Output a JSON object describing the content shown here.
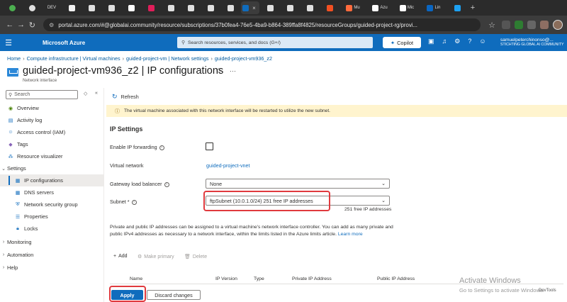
{
  "browser": {
    "tabs": [
      {
        "label": "",
        "color": "#4caf50"
      },
      {
        "label": "",
        "color": "#e0e0e0"
      },
      {
        "label": "DEV",
        "color": "#111111"
      },
      {
        "label": "",
        "color": "#f2f2f2"
      },
      {
        "label": "",
        "color": "#e0e0e0"
      },
      {
        "label": "",
        "color": "#e0e0e0"
      },
      {
        "label": "",
        "color": "#ffffff"
      },
      {
        "label": "",
        "color": "#e01e5a"
      },
      {
        "label": "",
        "color": "#e0e0e0"
      },
      {
        "label": "",
        "color": "#e0e0e0"
      },
      {
        "label": "",
        "color": "#e0e0e0"
      },
      {
        "label": "",
        "color": "#e0e0e0"
      },
      {
        "label": "",
        "color": "#e0e0e0"
      },
      {
        "label": "",
        "color": "#0f6cbd"
      },
      {
        "label": "",
        "color": "#e0e0e0"
      },
      {
        "label": "",
        "color": "#e0e0e0"
      },
      {
        "label": "",
        "color": "#e0e0e0"
      },
      {
        "label": "",
        "color": "#f25022"
      },
      {
        "label": "Mu",
        "color": "#ff6b3d"
      },
      {
        "label": "Azu",
        "color": "#ffffff"
      },
      {
        "label": "Mic",
        "color": "#ffffff"
      },
      {
        "label": "Lin",
        "color": "#0a66c2"
      },
      {
        "label": "",
        "color": "#1da1f2"
      }
    ],
    "url": "portal.azure.com/#@globalai.community/resource/subscriptions/37b0fea4-76e5-4ba9-b864-389ffa8f4825/resourceGroups/guided-project-rg/provi..."
  },
  "azure": {
    "brand": "Microsoft Azure",
    "search_placeholder": "Search resources, services, and docs (G+/)",
    "copilot_label": "Copilot",
    "user_name": "samuelpeterchinonso@...",
    "user_tenant": "STICHTING GLOBAL AI COMMUNITY"
  },
  "breadcrumb": {
    "items": [
      "Home",
      "Compute infrastructure | Virtual machines",
      "guided-project-vm | Network settings",
      "guided-project-vm936_z2"
    ]
  },
  "header": {
    "title": "guided-project-vm936_z2 | IP configurations",
    "subtitle": "Network interface"
  },
  "nav": {
    "search_placeholder": "Search",
    "items": [
      {
        "label": "Overview"
      },
      {
        "label": "Activity log"
      },
      {
        "label": "Access control (IAM)"
      },
      {
        "label": "Tags"
      },
      {
        "label": "Resource visualizer"
      },
      {
        "label": "Settings"
      },
      {
        "label": "IP configurations"
      },
      {
        "label": "DNS servers"
      },
      {
        "label": "Network security group"
      },
      {
        "label": "Properties"
      },
      {
        "label": "Locks"
      },
      {
        "label": "Monitoring"
      },
      {
        "label": "Automation"
      },
      {
        "label": "Help"
      }
    ]
  },
  "main": {
    "refresh_label": "Refresh",
    "banner_text": "The virtual machine associated with this network interface will be restarted to utilize the new subnet.",
    "section_title": "IP Settings",
    "fields": {
      "ip_forwarding_label": "Enable IP forwarding",
      "vnet_label": "Virtual network",
      "vnet_value": "guided-project-vnet",
      "glb_label": "Gateway load balancer",
      "glb_value": "None",
      "subnet_label": "Subnet *",
      "subnet_value": "ftpSubnet (10.0.1.0/24) 251 free IP addresses",
      "free_ip_note": "251 free IP addresses"
    },
    "description": "Private and public IP addresses can be assigned to a virtual machine's network interface controller. You can add as many private and public IPv4 addresses as necessary to a network interface, within the limits listed in the Azure limits article.",
    "learn_more": "Learn more",
    "toolbar": {
      "add_label": "Add",
      "make_primary_label": "Make primary",
      "delete_label": "Delete"
    },
    "grid_headers": [
      "Name",
      "IP Version",
      "Type",
      "Private IP Address",
      "Public IP Address"
    ],
    "apply_label": "Apply",
    "discard_label": "Discard changes"
  },
  "overlay": {
    "watermark_title": "Activate Windows",
    "watermark_sub": "Go to Settings to activate Windows.",
    "dev_tab_label": "DevTools"
  }
}
